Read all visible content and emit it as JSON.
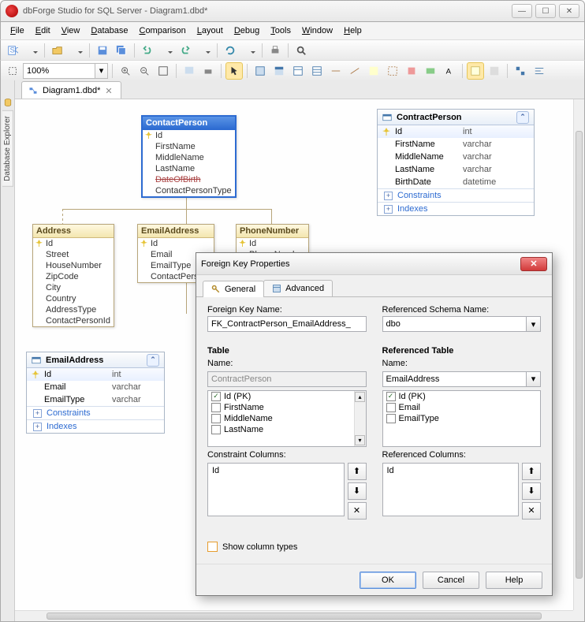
{
  "app": {
    "title": "dbForge Studio for SQL Server - Diagram1.dbd*"
  },
  "menu": [
    "File",
    "Edit",
    "View",
    "Database",
    "Comparison",
    "Layout",
    "Debug",
    "Tools",
    "Window",
    "Help"
  ],
  "toolbar1_names": [
    "new-sql",
    "sql-drop",
    "separator",
    "open",
    "open-drop",
    "separator",
    "save",
    "save-all",
    "separator",
    "undo",
    "redo",
    "separator",
    "refresh",
    "refresh-drop",
    "separator",
    "execute",
    "stop",
    "separator",
    "find"
  ],
  "toolbar2": {
    "zoom": "100%",
    "names": [
      "zoom-picker",
      "cursor",
      "zoom-in",
      "zoom-out",
      "fit",
      "separator",
      "export",
      "print",
      "separator",
      "select-mode",
      "pointer",
      "separator",
      "tool-a",
      "tool-b",
      "tool-c",
      "tool-d",
      "tool-e",
      "tool-f",
      "tool-g",
      "tool-h",
      "tool-i",
      "tool-j",
      "tool-k",
      "separator",
      "highlight",
      "color",
      "separator",
      "arrange",
      "align"
    ]
  },
  "sidebar_tab": "Database Explorer",
  "tab": {
    "label": "Diagram1.dbd*"
  },
  "diagram": {
    "contactPerson": {
      "title": "ContactPerson",
      "cols": [
        "Id",
        "FirstName",
        "MiddleName",
        "LastName",
        "DateOfBirth",
        "ContactPersonType"
      ],
      "strike": 4
    },
    "address": {
      "title": "Address",
      "cols": [
        "Id",
        "Street",
        "HouseNumber",
        "ZipCode",
        "City",
        "Country",
        "AddressType",
        "ContactPersonId"
      ]
    },
    "emailAddressSmall": {
      "title": "EmailAddress",
      "cols": [
        "Id",
        "Email",
        "EmailType",
        "ContactPersonI"
      ]
    },
    "phoneNumber": {
      "title": "PhoneNumber",
      "cols": [
        "Id",
        "PhoneNumber"
      ]
    }
  },
  "panel_contract": {
    "title": "ContractPerson",
    "rows": [
      {
        "name": "Id",
        "type": "int",
        "pk": true
      },
      {
        "name": "FirstName",
        "type": "varchar"
      },
      {
        "name": "MiddleName",
        "type": "varchar"
      },
      {
        "name": "LastName",
        "type": "varchar"
      },
      {
        "name": "BirthDate",
        "type": "datetime"
      }
    ],
    "sections": [
      "Constraints",
      "Indexes"
    ]
  },
  "panel_email": {
    "title": "EmailAddress",
    "rows": [
      {
        "name": "Id",
        "type": "int",
        "pk": true
      },
      {
        "name": "Email",
        "type": "varchar"
      },
      {
        "name": "EmailType",
        "type": "varchar"
      }
    ],
    "sections": [
      "Constraints",
      "Indexes"
    ]
  },
  "dialog": {
    "title": "Foreign Key Properties",
    "tabs": {
      "general": "General",
      "advanced": "Advanced"
    },
    "labels": {
      "fkname": "Foreign Key Name:",
      "refschema": "Referenced Schema Name:",
      "table": "Table",
      "reftable": "Referenced Table",
      "name": "Name:",
      "conscols": "Constraint Columns:",
      "refcols": "Referenced Columns:",
      "showtypes": "Show column types"
    },
    "fkname": "FK_ContractPerson_EmailAddress_",
    "refschema": "dbo",
    "tablename": "ContractPerson",
    "reftablename": "EmailAddress",
    "tablecols": [
      {
        "label": "Id (PK)",
        "checked": true
      },
      {
        "label": "FirstName",
        "checked": false
      },
      {
        "label": "MiddleName",
        "checked": false
      },
      {
        "label": "LastName",
        "checked": false
      }
    ],
    "refcols": [
      {
        "label": "Id (PK)",
        "checked": true
      },
      {
        "label": "Email",
        "checked": false
      },
      {
        "label": "EmailType",
        "checked": false
      }
    ],
    "conscol": "Id",
    "refcol": "Id",
    "buttons": {
      "ok": "OK",
      "cancel": "Cancel",
      "help": "Help"
    }
  }
}
